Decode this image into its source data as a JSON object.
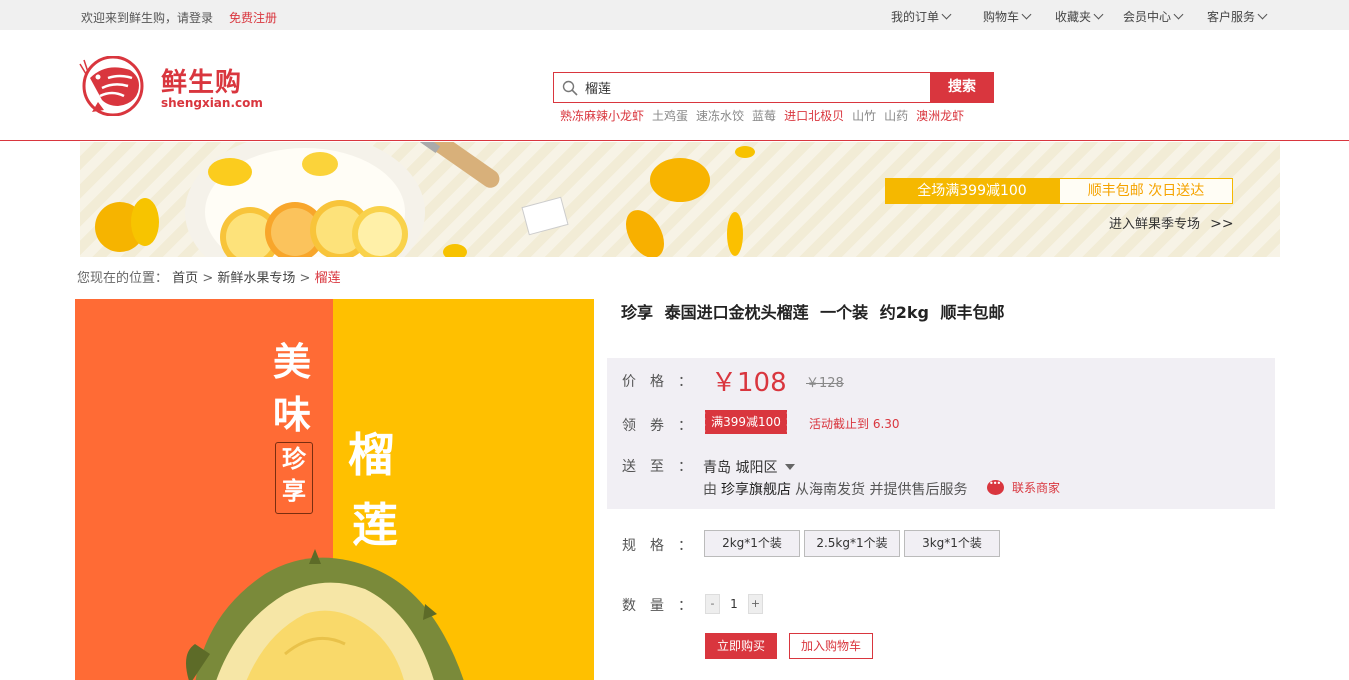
{
  "topbar": {
    "welcome": "欢迎来到鲜生购，请登录",
    "register": "免费注册",
    "nav": [
      "我的订单",
      "购物车",
      "收藏夹",
      "会员中心",
      "客户服务"
    ]
  },
  "logo": {
    "cn": "鲜生购",
    "en": "shengxian.com"
  },
  "search": {
    "value": "榴莲",
    "button": "搜索"
  },
  "hot_words": [
    {
      "text": "熟冻麻辣小龙虾",
      "hot": true
    },
    {
      "text": "土鸡蛋",
      "hot": false
    },
    {
      "text": "速冻水饺",
      "hot": false
    },
    {
      "text": "蓝莓",
      "hot": false
    },
    {
      "text": "进口北极贝",
      "hot": true
    },
    {
      "text": "山竹",
      "hot": false
    },
    {
      "text": "山药",
      "hot": false
    },
    {
      "text": "澳洲龙虾",
      "hot": true
    }
  ],
  "banner": {
    "promo_full": "全场满399减100",
    "promo_ship": "顺丰包邮  次日送达",
    "enter": "进入鲜果季专场"
  },
  "breadcrumb": {
    "prefix": "您现在的位置：",
    "home": "首页",
    "sep": ">",
    "category": "新鲜水果专场",
    "current": "榴莲"
  },
  "product_image": {
    "text_left_1": "美",
    "text_left_2": "味",
    "seal_1": "珍",
    "seal_2": "享",
    "text_right_1": "榴",
    "text_right_2": "莲"
  },
  "product": {
    "title": "珍享  泰国进口金枕头榴莲  一个装  约2kg  顺丰包邮",
    "price_label": "价格：",
    "price": "￥108",
    "old_price": "￥128",
    "coupon_label": "领券：",
    "coupon": "满399减100",
    "deadline": "活动截止到  6.30",
    "ship_label": "送至：",
    "region": "青岛  城阳区",
    "ship_from_prefix": "由",
    "shop": "珍享旗舰店",
    "ship_from_suffix": "从海南发货  并提供售后服务",
    "contact": "联系商家",
    "spec_label": "规格：",
    "specs": [
      "2kg*1个装",
      "2.5kg*1个装",
      "3kg*1个装"
    ],
    "qty_label": "数量：",
    "qty_minus": "-",
    "qty": "1",
    "qty_plus": "+",
    "buy": "立即购买",
    "cart": "加入购物车"
  },
  "colors": {
    "brand": "#d9363e",
    "accent": "#f5b800"
  }
}
